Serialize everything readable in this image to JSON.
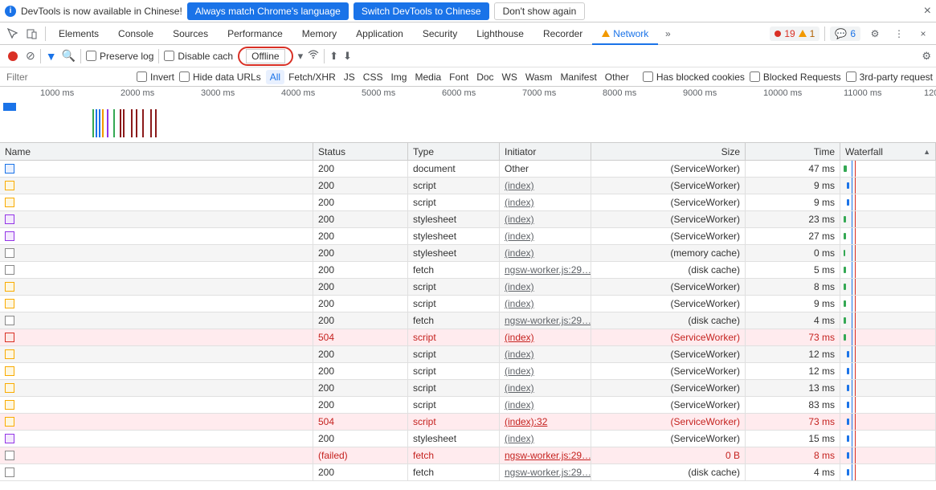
{
  "infobar": {
    "msg": "DevTools is now available in Chinese!",
    "btn1": "Always match Chrome's language",
    "btn2": "Switch DevTools to Chinese",
    "btn3": "Don't show again"
  },
  "tabs": {
    "list": [
      "Elements",
      "Console",
      "Sources",
      "Performance",
      "Memory",
      "Application",
      "Security",
      "Lighthouse",
      "Recorder"
    ],
    "active": "Network",
    "errors": "19",
    "warns": "1",
    "msgs": "6"
  },
  "toolbar": {
    "preserve": "Preserve log",
    "disable": "Disable cach",
    "throttle": "Offline"
  },
  "filter": {
    "placeholder": "Filter",
    "invert": "Invert",
    "hide": "Hide data URLs",
    "types": [
      "All",
      "Fetch/XHR",
      "JS",
      "CSS",
      "Img",
      "Media",
      "Font",
      "Doc",
      "WS",
      "Wasm",
      "Manifest",
      "Other"
    ],
    "blocked": "Has blocked cookies",
    "blockedreq": "Blocked Requests",
    "thirdparty": "3rd-party request"
  },
  "timeline": {
    "ticks": [
      "1000 ms",
      "2000 ms",
      "3000 ms",
      "4000 ms",
      "5000 ms",
      "6000 ms",
      "7000 ms",
      "8000 ms",
      "9000 ms",
      "10000 ms",
      "11000 ms",
      "120"
    ]
  },
  "columns": {
    "name": "Name",
    "status": "Status",
    "type": "Type",
    "initiator": "Initiator",
    "size": "Size",
    "time": "Time",
    "waterfall": "Waterfall"
  },
  "rows": [
    {
      "ic": "blue",
      "status": "200",
      "type": "document",
      "init": "Other",
      "init_link": false,
      "size": "(ServiceWorker)",
      "time": "47 ms",
      "err": false,
      "wf": 4,
      "wfw": 4,
      "wfc": "green"
    },
    {
      "ic": "yellow",
      "status": "200",
      "type": "script",
      "init": "(index)",
      "init_link": true,
      "size": "(ServiceWorker)",
      "time": "9 ms",
      "err": false,
      "wf": 8,
      "wfw": 3,
      "wfc": "blue"
    },
    {
      "ic": "yellow",
      "status": "200",
      "type": "script",
      "init": "(index)",
      "init_link": true,
      "size": "(ServiceWorker)",
      "time": "9 ms",
      "err": false,
      "wf": 8,
      "wfw": 3,
      "wfc": "blue"
    },
    {
      "ic": "purple",
      "status": "200",
      "type": "stylesheet",
      "init": "(index)",
      "init_link": true,
      "size": "(ServiceWorker)",
      "time": "23 ms",
      "err": false,
      "wf": 4,
      "wfw": 3,
      "wfc": "green"
    },
    {
      "ic": "purple",
      "status": "200",
      "type": "stylesheet",
      "init": "(index)",
      "init_link": true,
      "size": "(ServiceWorker)",
      "time": "27 ms",
      "err": false,
      "wf": 4,
      "wfw": 3,
      "wfc": "green"
    },
    {
      "ic": "gray",
      "status": "200",
      "type": "stylesheet",
      "init": "(index)",
      "init_link": true,
      "size": "(memory cache)",
      "time": "0 ms",
      "err": false,
      "wf": 4,
      "wfw": 2,
      "wfc": "green"
    },
    {
      "ic": "gray",
      "status": "200",
      "type": "fetch",
      "init": "ngsw-worker.js:29…",
      "init_link": true,
      "size": "(disk cache)",
      "time": "5 ms",
      "err": false,
      "wf": 4,
      "wfw": 3,
      "wfc": "green"
    },
    {
      "ic": "yellow",
      "status": "200",
      "type": "script",
      "init": "(index)",
      "init_link": true,
      "size": "(ServiceWorker)",
      "time": "8 ms",
      "err": false,
      "wf": 4,
      "wfw": 3,
      "wfc": "green"
    },
    {
      "ic": "yellow",
      "status": "200",
      "type": "script",
      "init": "(index)",
      "init_link": true,
      "size": "(ServiceWorker)",
      "time": "9 ms",
      "err": false,
      "wf": 4,
      "wfw": 3,
      "wfc": "green"
    },
    {
      "ic": "gray",
      "status": "200",
      "type": "fetch",
      "init": "ngsw-worker.js:29…",
      "init_link": true,
      "size": "(disk cache)",
      "time": "4 ms",
      "err": false,
      "wf": 4,
      "wfw": 3,
      "wfc": "green"
    },
    {
      "ic": "red",
      "status": "504",
      "type": "script",
      "init": "(index)",
      "init_link": true,
      "size": "(ServiceWorker)",
      "time": "73 ms",
      "err": true,
      "wf": 4,
      "wfw": 3,
      "wfc": "green"
    },
    {
      "ic": "yellow",
      "status": "200",
      "type": "script",
      "init": "(index)",
      "init_link": true,
      "size": "(ServiceWorker)",
      "time": "12 ms",
      "err": false,
      "wf": 8,
      "wfw": 3,
      "wfc": "blue"
    },
    {
      "ic": "yellow",
      "status": "200",
      "type": "script",
      "init": "(index)",
      "init_link": true,
      "size": "(ServiceWorker)",
      "time": "12 ms",
      "err": false,
      "wf": 8,
      "wfw": 3,
      "wfc": "blue"
    },
    {
      "ic": "yellow",
      "status": "200",
      "type": "script",
      "init": "(index)",
      "init_link": true,
      "size": "(ServiceWorker)",
      "time": "13 ms",
      "err": false,
      "wf": 8,
      "wfw": 3,
      "wfc": "blue"
    },
    {
      "ic": "yellow",
      "status": "200",
      "type": "script",
      "init": "(index)",
      "init_link": true,
      "size": "(ServiceWorker)",
      "time": "83 ms",
      "err": false,
      "wf": 8,
      "wfw": 3,
      "wfc": "blue"
    },
    {
      "ic": "yellow",
      "status": "504",
      "type": "script",
      "init": "(index):32",
      "init_link": true,
      "size": "(ServiceWorker)",
      "time": "73 ms",
      "err": true,
      "wf": 8,
      "wfw": 3,
      "wfc": "blue"
    },
    {
      "ic": "purple",
      "status": "200",
      "type": "stylesheet",
      "init": "(index)",
      "init_link": true,
      "size": "(ServiceWorker)",
      "time": "15 ms",
      "err": false,
      "wf": 8,
      "wfw": 3,
      "wfc": "blue"
    },
    {
      "ic": "gray",
      "status": "(failed)",
      "type": "fetch",
      "init": "ngsw-worker.js:29…",
      "init_link": true,
      "size": "0 B",
      "time": "8 ms",
      "err": true,
      "wf": 8,
      "wfw": 3,
      "wfc": "blue"
    },
    {
      "ic": "gray",
      "status": "200",
      "type": "fetch",
      "init": "ngsw-worker.js:29…",
      "init_link": true,
      "size": "(disk cache)",
      "time": "4 ms",
      "err": false,
      "wf": 8,
      "wfw": 3,
      "wfc": "blue"
    }
  ]
}
